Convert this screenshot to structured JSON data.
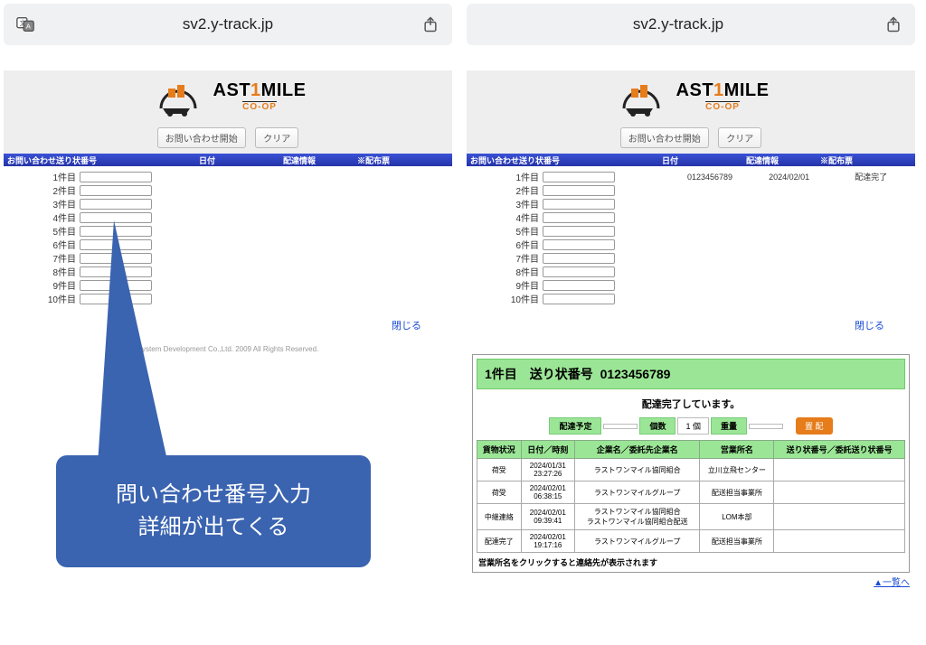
{
  "url": "sv2.y-track.jp",
  "logo": {
    "main_a": "AST",
    "main_1": "1",
    "main_b": "MILE",
    "sub": "CO-OP"
  },
  "buttons": {
    "start": "お問い合わせ開始",
    "clear": "クリア"
  },
  "headers": {
    "h1": "お問い合わせ送り状番号",
    "h2": "日付",
    "h3": "配達情報",
    "h4": "※配布票"
  },
  "rows": {
    "labels": [
      "1件目",
      "2件目",
      "3件目",
      "4件目",
      "5件目",
      "6件目",
      "7件目",
      "8件目",
      "9件目",
      "10件目"
    ],
    "filled": {
      "num": "0123456789",
      "date": "2024/02/01",
      "status": "配達完了"
    }
  },
  "close": "閉じる",
  "copyright": "System Development Co.,Ltd. 2009 All Rights Reserved.",
  "callout": {
    "l1": "問い合わせ番号入力",
    "l2": "詳細が出てくる"
  },
  "detail": {
    "title_prefix": "1件目　送り状番号",
    "title_num": "0123456789",
    "status": "配達完了しています。",
    "mini": {
      "yotei": "配達予定",
      "yotei_v": "",
      "kosu": "個数",
      "kosu_v": "1 個",
      "juryo": "重量",
      "juryo_v": "",
      "place": "置 配"
    },
    "thead": [
      "貨物状況",
      "日付／時刻",
      "企業名／委託先企業名",
      "営業所名",
      "送り状番号／委託送り状番号"
    ],
    "tbody": [
      {
        "s": "荷受",
        "dt": "2024/01/31\n23:27:26",
        "co": "ラストワンマイル協同組合",
        "of": "立川立飛センター",
        "no": ""
      },
      {
        "s": "荷受",
        "dt": "2024/02/01\n06:38:15",
        "co": "ラストワンマイルグループ",
        "of": "配送担当事業所",
        "no": ""
      },
      {
        "s": "中継連絡",
        "dt": "2024/02/01\n09:39:41",
        "co": "ラストワンマイル協同組合\nラストワンマイル協同組合配送",
        "of": "LOM本部",
        "no": ""
      },
      {
        "s": "配達完了",
        "dt": "2024/02/01\n19:17:16",
        "co": "ラストワンマイルグループ",
        "of": "配送担当事業所",
        "no": ""
      }
    ],
    "note": "営業所名をクリックすると連絡先が表示されます",
    "list_link": "▲一覧へ"
  }
}
